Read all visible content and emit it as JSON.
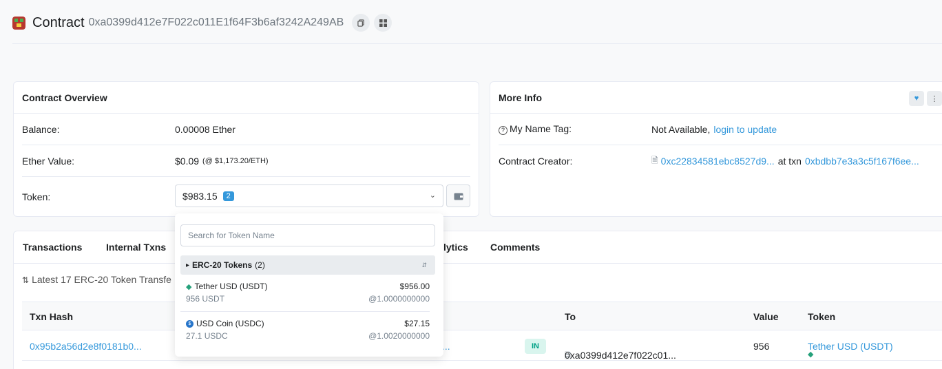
{
  "header": {
    "title": "Contract",
    "address": "0xa0399d412e7F022c011E1f64F3b6af3242A249AB",
    "copy_icon": "copy-icon",
    "qr_icon": "qr-code-icon"
  },
  "overview": {
    "title": "Contract Overview",
    "balance_label": "Balance:",
    "balance_value": "0.00008 Ether",
    "ether_value_label": "Ether Value:",
    "ether_value": "$0.09",
    "ether_rate": "(@ $1,173.20/ETH)",
    "token_label": "Token:",
    "token_value": "$983.15",
    "token_count": "2"
  },
  "more_info": {
    "title": "More Info",
    "name_tag_label": "My Name Tag:",
    "name_tag_value": "Not Available,",
    "name_tag_link": "login to update",
    "creator_label": "Contract Creator:",
    "creator_address": "0xc22834581ebc8527d9...",
    "creator_at": "at txn",
    "creator_txn": "0xbdbb7e3a3c5f167f6ee..."
  },
  "tabs": {
    "items": [
      "Transactions",
      "Internal Txns",
      "lytics",
      "Comments"
    ]
  },
  "transfers": {
    "latest": "Latest 17 ERC-20 Token Transfe",
    "columns": [
      "Txn Hash",
      "To",
      "Value",
      "Token"
    ],
    "row": {
      "hash": "0x95b2a56d2e8f0181b0...",
      "from_trunc": "...",
      "direction": "IN",
      "to": "0xa0399d412e7f022c01...",
      "value": "956",
      "token": "Tether USD (USDT)"
    }
  },
  "dropdown": {
    "search_placeholder": "Search for Token Name",
    "group_label": "ERC-20 Tokens",
    "group_count": "(2)",
    "tokens": [
      {
        "name": "Tether USD (USDT)",
        "usd": "$956.00",
        "amount": "956 USDT",
        "rate": "@1.0000000000",
        "icon": "tether-icon"
      },
      {
        "name": "USD Coin (USDC)",
        "usd": "$27.15",
        "amount": "27.1 USDC",
        "rate": "@1.0020000000",
        "icon": "usd-coin-icon"
      }
    ]
  },
  "colors": {
    "link": "#3498db",
    "badge": "#3498db",
    "in_badge_bg": "#d9f5ee",
    "in_badge_text": "#00a186",
    "tether": "#26a17b"
  }
}
